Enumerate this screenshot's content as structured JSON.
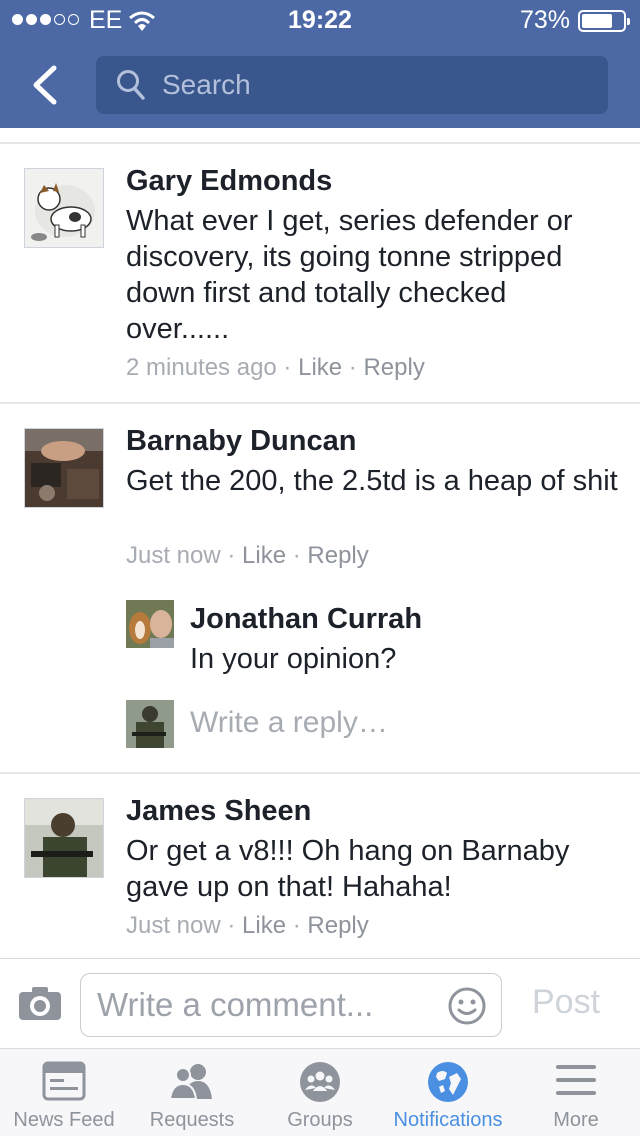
{
  "status_bar": {
    "carrier": "EE",
    "time": "19:22",
    "battery": "73%"
  },
  "header": {
    "search_placeholder": "Search"
  },
  "comments": [
    {
      "author": "Gary Edmonds",
      "text": "What ever I get, series defender or discovery, its going tonne stripped down first and totally checked over......",
      "time": "2 minutes ago",
      "like": "Like",
      "reply": "Reply"
    },
    {
      "author": "Barnaby Duncan",
      "text": "Get the 200, the 2.5td is a heap of shit",
      "time": "Just now",
      "like": "Like",
      "reply": "Reply",
      "replies": [
        {
          "author": "Jonathan Currah",
          "text": "In your opinion?"
        }
      ],
      "reply_placeholder": "Write a reply…"
    },
    {
      "author": "James Sheen",
      "text": "Or get a v8!!! Oh hang on Barnaby gave up on that! Hahaha!",
      "time": "Just now",
      "like": "Like",
      "reply": "Reply"
    }
  ],
  "composer": {
    "placeholder": "Write a comment...",
    "post_label": "Post"
  },
  "tabs": [
    {
      "label": "News Feed",
      "icon": "news-feed-icon"
    },
    {
      "label": "Requests",
      "icon": "friends-icon"
    },
    {
      "label": "Groups",
      "icon": "groups-icon"
    },
    {
      "label": "Notifications",
      "icon": "globe-icon",
      "active": true
    },
    {
      "label": "More",
      "icon": "menu-icon"
    }
  ],
  "colors": {
    "header": "#4c69a6",
    "search_field": "#39568d",
    "active_tab": "#4a8fe2",
    "meta": "#a7abb2"
  }
}
